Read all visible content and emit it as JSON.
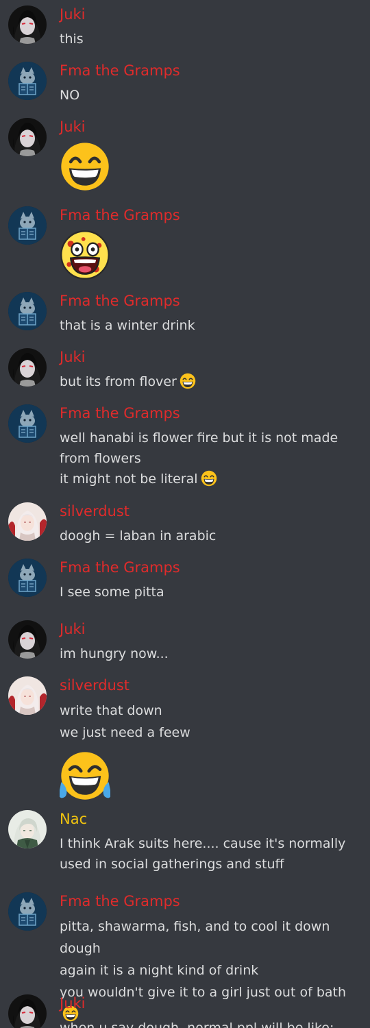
{
  "users": {
    "juki": "Juki",
    "fma": "Fma the Gramps",
    "silver": "silverdust",
    "nac": "Nac"
  },
  "colors": {
    "background": "#36393f",
    "author_red": "#e02b2b",
    "author_yellow": "#f1c40f",
    "message_text": "#dcddde"
  },
  "messages": [
    {
      "author": "Juki",
      "avatar": "juki-avatar",
      "lines": [
        "this"
      ]
    },
    {
      "author": "Fma the Gramps",
      "avatar": "fma-avatar",
      "lines": [
        "NO"
      ]
    },
    {
      "author": "Juki",
      "avatar": "juki-avatar",
      "emoji": "grinning-smiling-eyes-emoji"
    },
    {
      "author": "Fma the Gramps",
      "avatar": "fma-avatar",
      "emoji": "awesome-face-emoji"
    },
    {
      "author": "Fma the Gramps",
      "avatar": "fma-avatar",
      "lines": [
        "that is a winter drink"
      ]
    },
    {
      "author": "Juki",
      "avatar": "juki-avatar",
      "lines": [
        "but its from flover"
      ],
      "inline_emoji": "grinning-smiling-eyes-emoji"
    },
    {
      "author": "Fma the Gramps",
      "avatar": "fma-avatar",
      "lines": [
        "well hanabi is flower fire but it is not made from flowers",
        "it might not be literal"
      ],
      "inline_emoji": "grinning-smiling-eyes-emoji"
    },
    {
      "author": "silverdust",
      "avatar": "silverdust-avatar",
      "lines": [
        "doogh = laban in arabic"
      ]
    },
    {
      "author": "Fma the Gramps",
      "avatar": "fma-avatar",
      "lines": [
        "I see some pitta"
      ]
    },
    {
      "author": "Juki",
      "avatar": "juki-avatar",
      "lines": [
        "im hungry now..."
      ]
    },
    {
      "author": "silverdust",
      "avatar": "silverdust-avatar",
      "lines": [
        "write that down",
        "we just need a feew"
      ],
      "emoji": "tears-of-joy-emoji"
    },
    {
      "author": "Nac",
      "avatar": "nac-avatar",
      "lines": [
        "I think Arak suits here.... cause it's normally used in social gatherings and stuff"
      ]
    },
    {
      "author": "Fma the Gramps",
      "avatar": "fma-avatar",
      "lines": [
        "pitta, shawarma, fish, and to cool it down dough",
        "again it is a night kind of drink",
        "you wouldn't give it to a girl just out of bath"
      ],
      "inline_emoji": "grinning-smiling-eyes-emoji"
    },
    {
      "author": "Juki",
      "avatar": "juki-avatar",
      "lines": [
        "when u say dough, normal ppl will be like:"
      ]
    }
  ]
}
